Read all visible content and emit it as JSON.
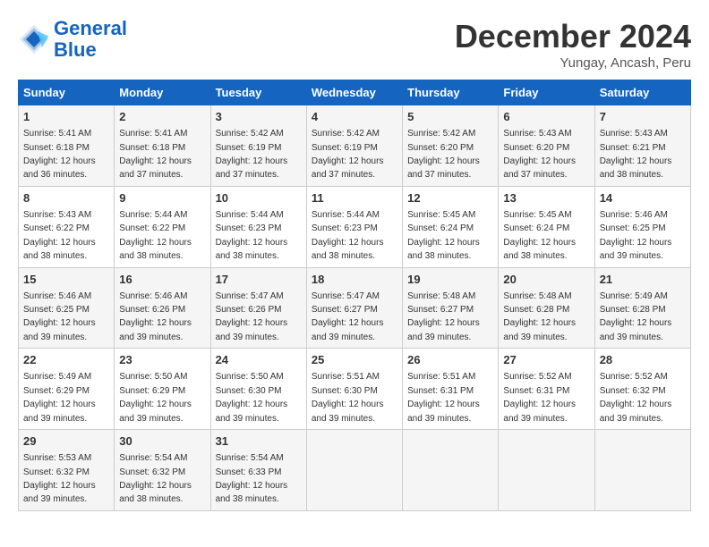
{
  "header": {
    "logo_line1": "General",
    "logo_line2": "Blue",
    "month_title": "December 2024",
    "location": "Yungay, Ancash, Peru"
  },
  "days_of_week": [
    "Sunday",
    "Monday",
    "Tuesday",
    "Wednesday",
    "Thursday",
    "Friday",
    "Saturday"
  ],
  "weeks": [
    [
      {
        "day": "1",
        "detail": "Sunrise: 5:41 AM\nSunset: 6:18 PM\nDaylight: 12 hours\nand 36 minutes."
      },
      {
        "day": "2",
        "detail": "Sunrise: 5:41 AM\nSunset: 6:18 PM\nDaylight: 12 hours\nand 37 minutes."
      },
      {
        "day": "3",
        "detail": "Sunrise: 5:42 AM\nSunset: 6:19 PM\nDaylight: 12 hours\nand 37 minutes."
      },
      {
        "day": "4",
        "detail": "Sunrise: 5:42 AM\nSunset: 6:19 PM\nDaylight: 12 hours\nand 37 minutes."
      },
      {
        "day": "5",
        "detail": "Sunrise: 5:42 AM\nSunset: 6:20 PM\nDaylight: 12 hours\nand 37 minutes."
      },
      {
        "day": "6",
        "detail": "Sunrise: 5:43 AM\nSunset: 6:20 PM\nDaylight: 12 hours\nand 37 minutes."
      },
      {
        "day": "7",
        "detail": "Sunrise: 5:43 AM\nSunset: 6:21 PM\nDaylight: 12 hours\nand 38 minutes."
      }
    ],
    [
      {
        "day": "8",
        "detail": "Sunrise: 5:43 AM\nSunset: 6:22 PM\nDaylight: 12 hours\nand 38 minutes."
      },
      {
        "day": "9",
        "detail": "Sunrise: 5:44 AM\nSunset: 6:22 PM\nDaylight: 12 hours\nand 38 minutes."
      },
      {
        "day": "10",
        "detail": "Sunrise: 5:44 AM\nSunset: 6:23 PM\nDaylight: 12 hours\nand 38 minutes."
      },
      {
        "day": "11",
        "detail": "Sunrise: 5:44 AM\nSunset: 6:23 PM\nDaylight: 12 hours\nand 38 minutes."
      },
      {
        "day": "12",
        "detail": "Sunrise: 5:45 AM\nSunset: 6:24 PM\nDaylight: 12 hours\nand 38 minutes."
      },
      {
        "day": "13",
        "detail": "Sunrise: 5:45 AM\nSunset: 6:24 PM\nDaylight: 12 hours\nand 38 minutes."
      },
      {
        "day": "14",
        "detail": "Sunrise: 5:46 AM\nSunset: 6:25 PM\nDaylight: 12 hours\nand 39 minutes."
      }
    ],
    [
      {
        "day": "15",
        "detail": "Sunrise: 5:46 AM\nSunset: 6:25 PM\nDaylight: 12 hours\nand 39 minutes."
      },
      {
        "day": "16",
        "detail": "Sunrise: 5:46 AM\nSunset: 6:26 PM\nDaylight: 12 hours\nand 39 minutes."
      },
      {
        "day": "17",
        "detail": "Sunrise: 5:47 AM\nSunset: 6:26 PM\nDaylight: 12 hours\nand 39 minutes."
      },
      {
        "day": "18",
        "detail": "Sunrise: 5:47 AM\nSunset: 6:27 PM\nDaylight: 12 hours\nand 39 minutes."
      },
      {
        "day": "19",
        "detail": "Sunrise: 5:48 AM\nSunset: 6:27 PM\nDaylight: 12 hours\nand 39 minutes."
      },
      {
        "day": "20",
        "detail": "Sunrise: 5:48 AM\nSunset: 6:28 PM\nDaylight: 12 hours\nand 39 minutes."
      },
      {
        "day": "21",
        "detail": "Sunrise: 5:49 AM\nSunset: 6:28 PM\nDaylight: 12 hours\nand 39 minutes."
      }
    ],
    [
      {
        "day": "22",
        "detail": "Sunrise: 5:49 AM\nSunset: 6:29 PM\nDaylight: 12 hours\nand 39 minutes."
      },
      {
        "day": "23",
        "detail": "Sunrise: 5:50 AM\nSunset: 6:29 PM\nDaylight: 12 hours\nand 39 minutes."
      },
      {
        "day": "24",
        "detail": "Sunrise: 5:50 AM\nSunset: 6:30 PM\nDaylight: 12 hours\nand 39 minutes."
      },
      {
        "day": "25",
        "detail": "Sunrise: 5:51 AM\nSunset: 6:30 PM\nDaylight: 12 hours\nand 39 minutes."
      },
      {
        "day": "26",
        "detail": "Sunrise: 5:51 AM\nSunset: 6:31 PM\nDaylight: 12 hours\nand 39 minutes."
      },
      {
        "day": "27",
        "detail": "Sunrise: 5:52 AM\nSunset: 6:31 PM\nDaylight: 12 hours\nand 39 minutes."
      },
      {
        "day": "28",
        "detail": "Sunrise: 5:52 AM\nSunset: 6:32 PM\nDaylight: 12 hours\nand 39 minutes."
      }
    ],
    [
      {
        "day": "29",
        "detail": "Sunrise: 5:53 AM\nSunset: 6:32 PM\nDaylight: 12 hours\nand 39 minutes."
      },
      {
        "day": "30",
        "detail": "Sunrise: 5:54 AM\nSunset: 6:32 PM\nDaylight: 12 hours\nand 38 minutes."
      },
      {
        "day": "31",
        "detail": "Sunrise: 5:54 AM\nSunset: 6:33 PM\nDaylight: 12 hours\nand 38 minutes."
      },
      null,
      null,
      null,
      null
    ]
  ]
}
